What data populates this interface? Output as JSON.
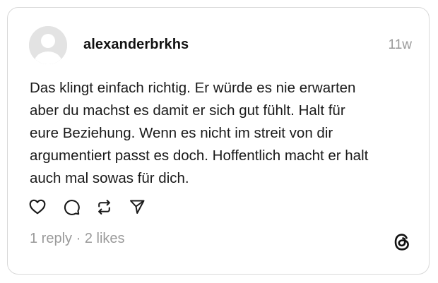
{
  "post": {
    "username": "alexanderbrkhs",
    "timestamp": "11w",
    "text_lines": [
      "Das klingt einfach richtig. Er würde es nie erwarten",
      "aber du machst es damit er sich gut fühlt. Halt für",
      "eure Beziehung. Wenn es nicht im streit von dir",
      "argumentiert passt es doch. Hoffentlich macht er halt",
      "auch mal sowas für dich."
    ],
    "reply_count_text": "1 reply",
    "separator": "·",
    "likes_count_text": "2 likes"
  },
  "icons": {
    "avatar": "default-avatar-icon",
    "like": "heart-icon",
    "reply": "comment-icon",
    "repost": "repost-icon",
    "share": "send-icon",
    "brand": "threads-logo-icon"
  },
  "colors": {
    "text": "#1a1a1a",
    "muted": "#9a9a9a",
    "border": "#d9d9d9",
    "avatar_bg": "#e6e6e6"
  }
}
